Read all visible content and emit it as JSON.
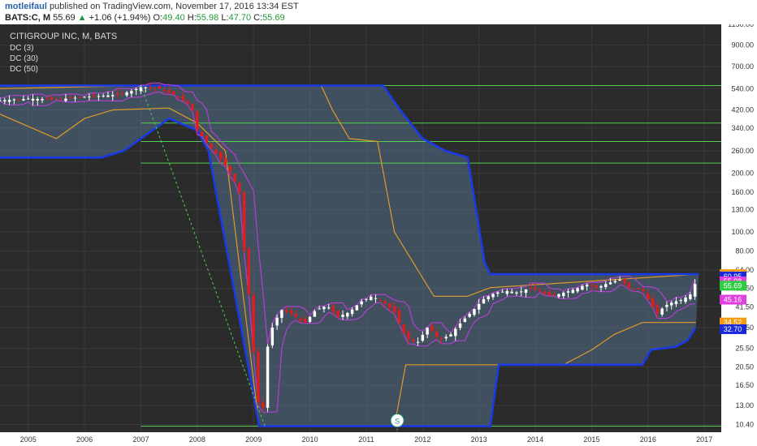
{
  "header": {
    "author": "motleifaul",
    "published": "published on TradingView.com, November 17, 2016 13:34 EST",
    "symbol": "BATS:C, M",
    "last": "55.69",
    "change": "+1.06 (+1.94%)",
    "o_label": "O:",
    "o_val": "49.40",
    "h_label": "H:",
    "h_val": "55.98",
    "l_label": "L:",
    "l_val": "47.70",
    "c_label": "C:",
    "c_val": "55.69"
  },
  "legend": {
    "title": "CITIGROUP INC, M, BATS",
    "items": [
      "DC (3)",
      "DC (30)",
      "DC (50)"
    ]
  },
  "colors": {
    "background": "#2b2b2b",
    "grid": "#3a3a3a",
    "candle_up": "#ffffff",
    "candle_down": "#e01e1e",
    "dc3": "#b040d0",
    "dc30": "#e09a2a",
    "dc50": "#1a3ae8",
    "hline": "#4fd04f",
    "fill": "#5b7fa0"
  },
  "chart_data": {
    "type": "candlestick",
    "title": "CITIGROUP INC, M, BATS",
    "y_scale": "log",
    "ylim": [
      9.5,
      1150
    ],
    "xlim": [
      2004.5,
      2017.3
    ],
    "x_ticks": [
      "2005",
      "2006",
      "2007",
      "2008",
      "2009",
      "2010",
      "2011",
      "2012",
      "2013",
      "2014",
      "2015",
      "2016",
      "2017"
    ],
    "y_ticks": [
      "1150.00",
      "900.00",
      "700.00",
      "540.00",
      "420.00",
      "340.00",
      "260.00",
      "200.00",
      "160.00",
      "130.00",
      "100.00",
      "80.00",
      "64.00",
      "51.50",
      "41.50",
      "32.50",
      "25.50",
      "20.50",
      "16.50",
      "13.00",
      "10.40"
    ],
    "badges": [
      {
        "label": "60.95",
        "value": 60.95,
        "color": "#f39c12"
      },
      {
        "label": "60.95",
        "value": 59.3,
        "color": "#1a2ad8"
      },
      {
        "label": "55.98",
        "value": 55.98,
        "color": "#e040e0"
      },
      {
        "label": "55.69",
        "value": 53.2,
        "color": "#2ecc40"
      },
      {
        "label": "45.16",
        "value": 45.16,
        "color": "#e040e0"
      },
      {
        "label": "34.52",
        "value": 34.52,
        "color": "#f39c12"
      },
      {
        "label": "32.70",
        "value": 31.9,
        "color": "#1a2ad8"
      }
    ],
    "horizontal_lines": [
      560,
      360,
      290,
      225,
      10.2
    ],
    "marker": {
      "label": "S",
      "x": 2011.55,
      "y": 10.7
    },
    "series": [
      {
        "name": "Price",
        "points": [
          [
            2004.5,
            470
          ],
          [
            2005.0,
            480
          ],
          [
            2005.5,
            475
          ],
          [
            2006.0,
            490
          ],
          [
            2006.5,
            500
          ],
          [
            2006.8,
            520
          ],
          [
            2007.0,
            550
          ],
          [
            2007.3,
            545
          ],
          [
            2007.6,
            500
          ],
          [
            2007.9,
            440
          ],
          [
            2008.0,
            330
          ],
          [
            2008.2,
            280
          ],
          [
            2008.4,
            240
          ],
          [
            2008.6,
            200
          ],
          [
            2008.75,
            160
          ],
          [
            2008.85,
            70
          ],
          [
            2008.95,
            40
          ],
          [
            2009.05,
            15
          ],
          [
            2009.15,
            11
          ],
          [
            2009.25,
            26
          ],
          [
            2009.35,
            34
          ],
          [
            2009.5,
            40
          ],
          [
            2009.7,
            38
          ],
          [
            2009.9,
            34
          ],
          [
            2010.1,
            40
          ],
          [
            2010.3,
            42
          ],
          [
            2010.5,
            37
          ],
          [
            2010.7,
            39
          ],
          [
            2010.9,
            44
          ],
          [
            2011.1,
            47
          ],
          [
            2011.3,
            44
          ],
          [
            2011.5,
            39
          ],
          [
            2011.7,
            29
          ],
          [
            2011.9,
            27
          ],
          [
            2012.1,
            33
          ],
          [
            2012.3,
            28
          ],
          [
            2012.5,
            30
          ],
          [
            2012.7,
            35
          ],
          [
            2012.9,
            40
          ],
          [
            2013.1,
            46
          ],
          [
            2013.3,
            49
          ],
          [
            2013.5,
            50
          ],
          [
            2013.7,
            49
          ],
          [
            2013.9,
            52
          ],
          [
            2014.1,
            49
          ],
          [
            2014.3,
            47
          ],
          [
            2014.5,
            49
          ],
          [
            2014.7,
            51
          ],
          [
            2014.9,
            54
          ],
          [
            2015.1,
            52
          ],
          [
            2015.3,
            55
          ],
          [
            2015.5,
            57
          ],
          [
            2015.7,
            51
          ],
          [
            2015.9,
            51
          ],
          [
            2016.05,
            43
          ],
          [
            2016.15,
            38
          ],
          [
            2016.3,
            42
          ],
          [
            2016.45,
            44
          ],
          [
            2016.6,
            45
          ],
          [
            2016.75,
            48
          ],
          [
            2016.85,
            55.69
          ]
        ]
      },
      {
        "name": "DC (50) upper",
        "points": [
          [
            2004.5,
            560
          ],
          [
            2007.0,
            560
          ],
          [
            2009.0,
            560
          ],
          [
            2011.3,
            560
          ],
          [
            2011.6,
            420
          ],
          [
            2012.0,
            300
          ],
          [
            2012.4,
            260
          ],
          [
            2012.8,
            240
          ],
          [
            2013.1,
            70
          ],
          [
            2013.2,
            60.95
          ],
          [
            2016.9,
            60.95
          ]
        ]
      },
      {
        "name": "DC (50) lower",
        "points": [
          [
            2004.5,
            240
          ],
          [
            2006.3,
            240
          ],
          [
            2006.7,
            260
          ],
          [
            2007.0,
            300
          ],
          [
            2007.5,
            380
          ],
          [
            2008.0,
            330
          ],
          [
            2008.2,
            260
          ],
          [
            2009.1,
            10.2
          ],
          [
            2013.2,
            10.2
          ],
          [
            2013.35,
            21
          ],
          [
            2015.9,
            21
          ],
          [
            2016.05,
            25
          ],
          [
            2016.5,
            26
          ],
          [
            2016.7,
            28
          ],
          [
            2016.85,
            32.7
          ]
        ]
      },
      {
        "name": "DC (30) upper",
        "points": [
          [
            2004.5,
            540
          ],
          [
            2007.0,
            560
          ],
          [
            2008.5,
            560
          ],
          [
            2009.0,
            560
          ],
          [
            2010.2,
            560
          ],
          [
            2010.4,
            420
          ],
          [
            2010.7,
            300
          ],
          [
            2011.2,
            290
          ],
          [
            2011.5,
            100
          ],
          [
            2012.2,
            47
          ],
          [
            2012.8,
            47
          ],
          [
            2013.2,
            52
          ],
          [
            2016.9,
            60.95
          ]
        ]
      },
      {
        "name": "DC (30) lower",
        "points": [
          [
            2004.5,
            400
          ],
          [
            2005.5,
            300
          ],
          [
            2006.0,
            380
          ],
          [
            2006.5,
            420
          ],
          [
            2007.5,
            430
          ],
          [
            2008.0,
            360
          ],
          [
            2008.5,
            260
          ],
          [
            2009.1,
            10.2
          ],
          [
            2011.5,
            10.2
          ],
          [
            2011.7,
            21
          ],
          [
            2014.5,
            21
          ],
          [
            2015.0,
            25
          ],
          [
            2015.4,
            30
          ],
          [
            2015.9,
            34.52
          ],
          [
            2016.85,
            34.52
          ]
        ]
      }
    ]
  }
}
